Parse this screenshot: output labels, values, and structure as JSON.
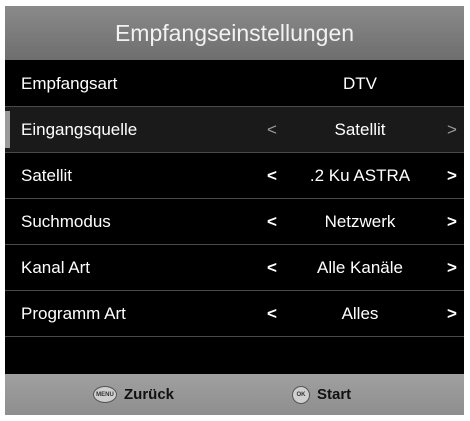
{
  "header": {
    "title": "Empfangseinstellungen"
  },
  "rows": [
    {
      "label": "Empfangsart",
      "value": "DTV",
      "has_arrows": false,
      "selected": false
    },
    {
      "label": "Eingangsquelle",
      "value": "Satellit",
      "has_arrows": true,
      "selected": true
    },
    {
      "label": "Satellit",
      "value": ".2 Ku ASTRA",
      "has_arrows": true,
      "selected": false
    },
    {
      "label": "Suchmodus",
      "value": "Netzwerk",
      "has_arrows": true,
      "selected": false
    },
    {
      "label": "Kanal Art",
      "value": "Alle Kanäle",
      "has_arrows": true,
      "selected": false
    },
    {
      "label": "Programm Art",
      "value": "Alles",
      "has_arrows": true,
      "selected": false
    }
  ],
  "arrows": {
    "left": "<",
    "right": ">"
  },
  "footer": {
    "back": {
      "icon_text": "MENU",
      "label": "Zurück",
      "icon": "menu-button-icon"
    },
    "start": {
      "icon_text": "OK",
      "label": "Start",
      "icon": "ok-button-icon"
    }
  }
}
